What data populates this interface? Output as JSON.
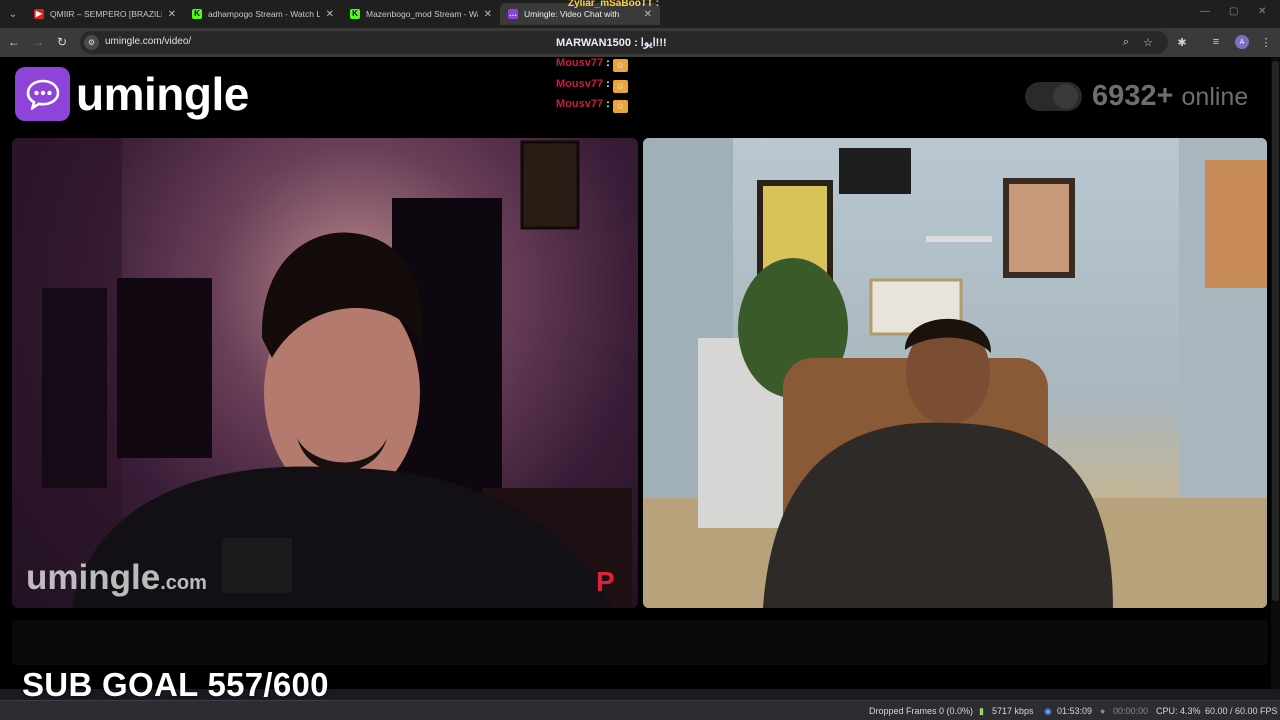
{
  "tabs": [
    {
      "title": "QMIIR – SEMPERO [BRAZILIAN",
      "favicon": "youtube-icon",
      "color": "#e02020",
      "active": false
    },
    {
      "title": "adhampogo Stream - Watch Li",
      "favicon": "kick-icon",
      "color": "#53fc18",
      "active": false
    },
    {
      "title": "Mazenbogo_mod Stream - Wa",
      "favicon": "kick-icon",
      "color": "#53fc18",
      "active": false
    },
    {
      "title": "Umingle: Video Chat with",
      "favicon": "umingle-icon",
      "color": "#8e44d8",
      "active": true
    }
  ],
  "address": {
    "url": "umingle.com/video/"
  },
  "site": {
    "brand": "umingle",
    "online_count": "6932",
    "online_plus": "+",
    "online_label": "online",
    "watermark": "umingle",
    "watermark_suffix": ".com",
    "watermark_mark": "P"
  },
  "chat_overlay": {
    "ghost_text": "Zyliar_mSaBooTT :",
    "messages": [
      {
        "user": "MARWAN1500",
        "text": ": ايوا!!!",
        "color": "#e8f0ff"
      },
      {
        "user": "Mousv77",
        "text": ":",
        "color": "#d11a3c"
      },
      {
        "user": "Mousv77",
        "text": ":",
        "color": "#d11a3c"
      },
      {
        "user": "Mousv77",
        "text": ":",
        "color": "#d11a3c"
      }
    ]
  },
  "overlay": {
    "sub_goal": "SUB GOAL 557/600"
  },
  "obs_status": {
    "dropped": "Dropped Frames 0 (0.0%)",
    "bitrate": "5717 kbps",
    "live_time": "01:53:09",
    "rec_time": "00:00:00",
    "cpu": "CPU: 4.3%",
    "fps": "60.00 / 60.00 FPS"
  },
  "colors": {
    "brand": "#8e44d8",
    "chat_user": "#d11a3c",
    "kick": "#53fc18"
  }
}
